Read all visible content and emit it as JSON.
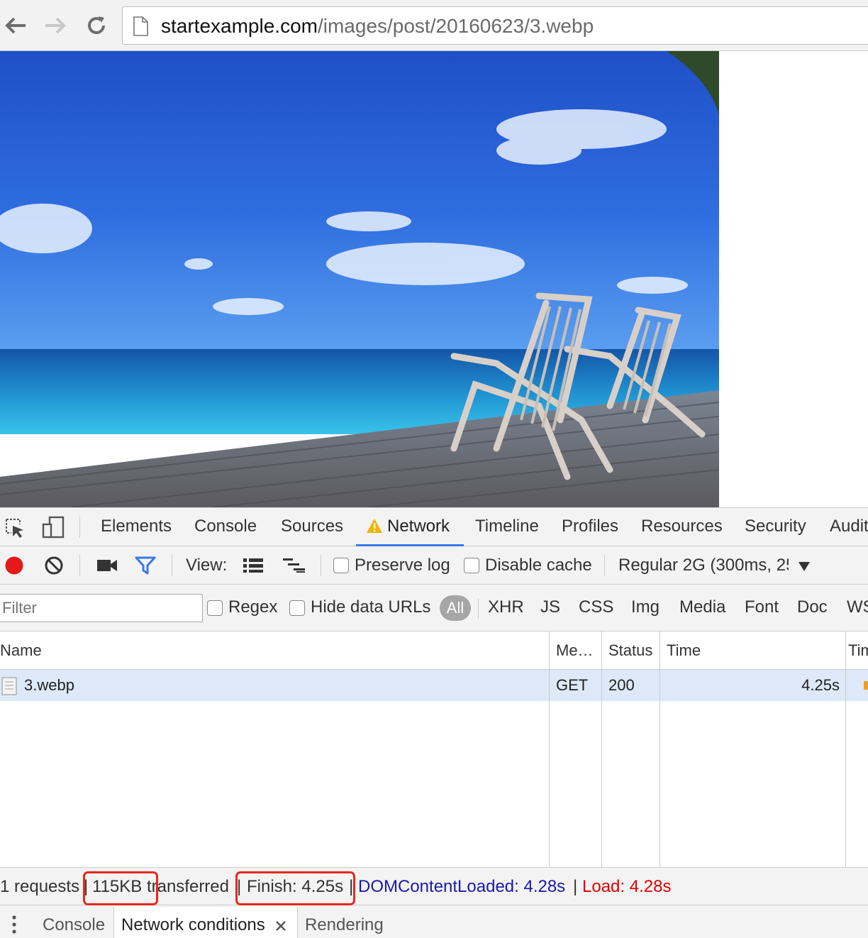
{
  "browser": {
    "url_host": "startexample.com",
    "url_path": "/images/post/20160623/3.webp"
  },
  "devtools": {
    "tabs": [
      "Elements",
      "Console",
      "Sources",
      "Network",
      "Timeline",
      "Profiles",
      "Resources",
      "Security",
      "Audit"
    ],
    "active_tab": "Network",
    "controls": {
      "view_label": "View:",
      "preserve_log": "Preserve log",
      "disable_cache": "Disable cache",
      "throttle": "Regular 2G (300ms, 25"
    },
    "filter": {
      "placeholder": "Filter",
      "regex": "Regex",
      "hide_data_urls": "Hide data URLs",
      "types": [
        "All",
        "XHR",
        "JS",
        "CSS",
        "Img",
        "Media",
        "Font",
        "Doc",
        "WS"
      ]
    },
    "table": {
      "headers": [
        "Name",
        "Me…",
        "Status",
        "Time",
        "Tim"
      ],
      "rows": [
        {
          "name": "3.webp",
          "method": "GET",
          "status": "200",
          "time": "4.25s"
        }
      ]
    },
    "summary": {
      "requests": "1 requests",
      "sep1": "|",
      "transferred": "115KB transferred",
      "sep2": "|",
      "finish": "Finish: 4.25s",
      "sep3": "|",
      "dom": "DOMContentLoaded: 4.28s",
      "sep4": "|",
      "load": "Load: 4.28s"
    },
    "drawer_tabs": {
      "console": "Console",
      "network_conditions": "Network conditions",
      "rendering": "Rendering"
    }
  },
  "colors": {
    "accent": "#3b78e7",
    "record": "#e51919",
    "highlight": "#e8281c"
  }
}
